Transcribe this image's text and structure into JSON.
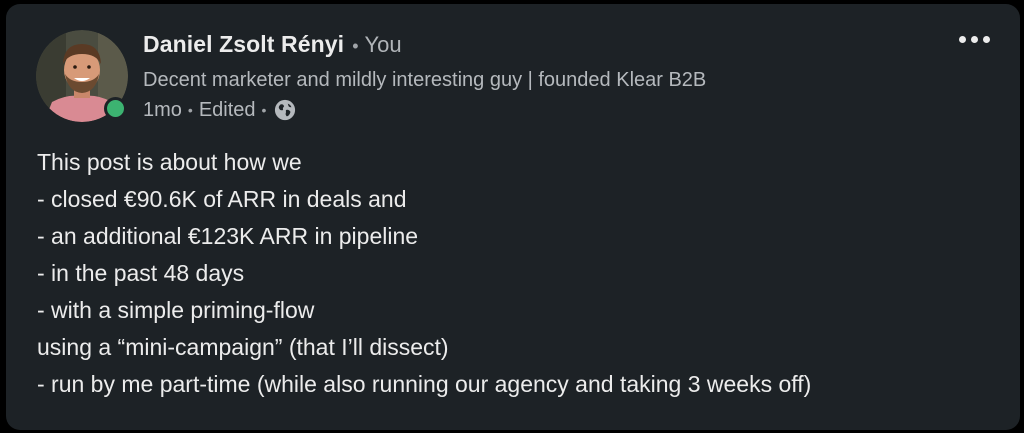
{
  "author": {
    "name": "Daniel Zsolt Rényi",
    "relation_dot": "•",
    "relation": "You",
    "headline": "Decent marketer and mildly interesting guy | founded Klear B2B",
    "online_status_color": "#3cb371"
  },
  "meta": {
    "age": "1mo",
    "sep1": "•",
    "edited": "Edited",
    "sep2": "•",
    "visibility_icon": "globe-icon"
  },
  "menu": {
    "icon": "more-horizontal-icon"
  },
  "post": {
    "lines": [
      "This post is about how we",
      "- closed €90.6K of ARR in deals and",
      "- an additional €123K ARR in pipeline",
      "- in the past 48 days",
      "- with a simple priming-flow",
      "using a “mini-campaign” (that I’ll dissect)",
      "- run by me part-time (while also running our agency and taking 3 weeks off)"
    ]
  },
  "colors": {
    "card_background": "#1d2226",
    "page_background": "#000000",
    "primary_text": "#ececec",
    "secondary_text": "#b5b9bd"
  }
}
